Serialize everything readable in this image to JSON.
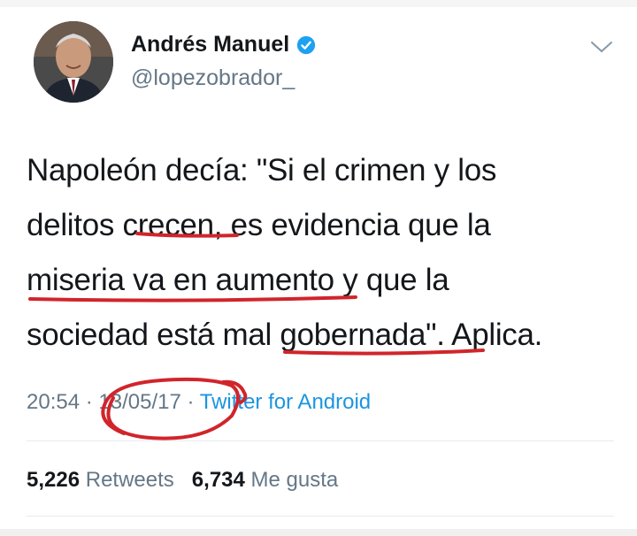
{
  "tweet": {
    "author_name": "Andrés Manuel",
    "author_handle": "@lopezobrador_",
    "text_lines": [
      "Napoleón decía: \"Si el crimen y los",
      "delitos crecen, es evidencia que la",
      "miseria va en aumento y que la",
      "sociedad está mal gobernada\". Aplica."
    ],
    "time": "20:54",
    "date": "13/05/17",
    "separator": "·",
    "source": "Twitter for Android",
    "retweets_count": "5,226",
    "retweets_label": "Retweets",
    "likes_count": "6,734",
    "likes_label": "Me gusta"
  },
  "colors": {
    "text": "#14171a",
    "secondary": "#657786",
    "link": "#1b95e0",
    "verified": "#1da1f2",
    "annotation": "#d0252b"
  },
  "icons": {
    "verified": "verified-badge-icon",
    "caret": "chevron-down-icon"
  }
}
